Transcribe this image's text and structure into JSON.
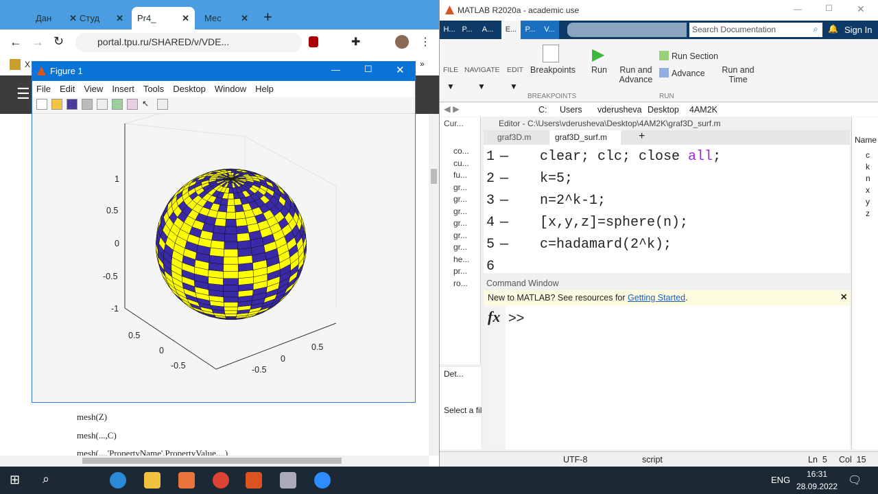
{
  "browser": {
    "tabs": [
      {
        "label": "Дан"
      },
      {
        "label": "Студ"
      },
      {
        "label": "Pr4_"
      },
      {
        "label": "Мес"
      }
    ],
    "new_tab": "+",
    "url": "portal.tpu.ru/SHARED/v/VDE...",
    "bookmark": "X",
    "more_bookmarks": "»",
    "page_lines": [
      "mesh(Z)",
      "mesh(...,C)",
      "mesh(...,'PropertyName',PropertyValue,...)"
    ]
  },
  "figure": {
    "title": "Figure 1",
    "menu": [
      "File",
      "Edit",
      "View",
      "Insert",
      "Tools",
      "Desktop",
      "Window",
      "Help"
    ],
    "z_ticks": [
      "1",
      "0.5",
      "0",
      "-0.5",
      "-1"
    ],
    "y_ticks": [
      "0.5",
      "0",
      "-0.5"
    ],
    "x_ticks": [
      "0.5",
      "0",
      "-0.5"
    ],
    "colors": {
      "yellow": "#ffff00",
      "blue": "#3a2aa8"
    }
  },
  "matlab": {
    "title": "MATLAB R2020a - academic use",
    "tabs": [
      "H...",
      "P...",
      "A...",
      "E...",
      "P...",
      "V..."
    ],
    "search_placeholder": "Search Documentation",
    "sign_in": "Sign In",
    "ribbon": {
      "file": "FILE",
      "navigate": "NAVIGATE",
      "edit": "EDIT",
      "breakpoints": "Breakpoints",
      "breakpoints_group": "BREAKPOINTS",
      "run": "Run",
      "run_advance": "Run and Advance",
      "run_section": "Run Section",
      "advance": "Advance",
      "run_time": "Run and Time",
      "run_group": "RUN"
    },
    "path": [
      "C:",
      "Users",
      "vderusheva",
      "Desktop",
      "4AM2K"
    ],
    "current_folder": {
      "header": "Cur...",
      "files": [
        "co...",
        "cu...",
        "fu...",
        "gr...",
        "gr...",
        "gr...",
        "gr...",
        "gr...",
        "gr...",
        "he...",
        "pr...",
        "ro..."
      ]
    },
    "details": {
      "header": "Det...",
      "text": "Select a fil"
    },
    "editor": {
      "header": "Editor - C:\\Users\\vderusheva\\Desktop\\4AM2K\\graf3D_surf.m",
      "tabs": [
        "graf3D.m",
        "graf3D_surf.m"
      ],
      "lines": [
        {
          "n": "1",
          "pre": "clear; clc; close ",
          "kw": "all",
          ";": ";"
        },
        {
          "n": "2",
          "pre": "k=5;"
        },
        {
          "n": "3",
          "pre": "n=2^k-1;"
        },
        {
          "n": "4",
          "pre": "[x,y,z]=sphere(n);"
        },
        {
          "n": "5",
          "pre": "c=hadamard(2^k);"
        },
        {
          "n": "6",
          "pre": ""
        }
      ]
    },
    "command": {
      "header": "Command Window",
      "banner_text": "New to MATLAB? See resources for ",
      "banner_link": "Getting Started",
      "banner_end": ".",
      "prompt": ">>",
      "fx": "fx"
    },
    "workspace": {
      "header": "Name",
      "vars": [
        "c",
        "k",
        "n",
        "x",
        "y",
        "z"
      ]
    },
    "status": {
      "encoding": "UTF-8",
      "type": "script",
      "ln": "Ln  5",
      "col": "Col  15"
    }
  },
  "taskbar": {
    "lang": "ENG",
    "time": "16:31",
    "date": "28.09.2022"
  }
}
